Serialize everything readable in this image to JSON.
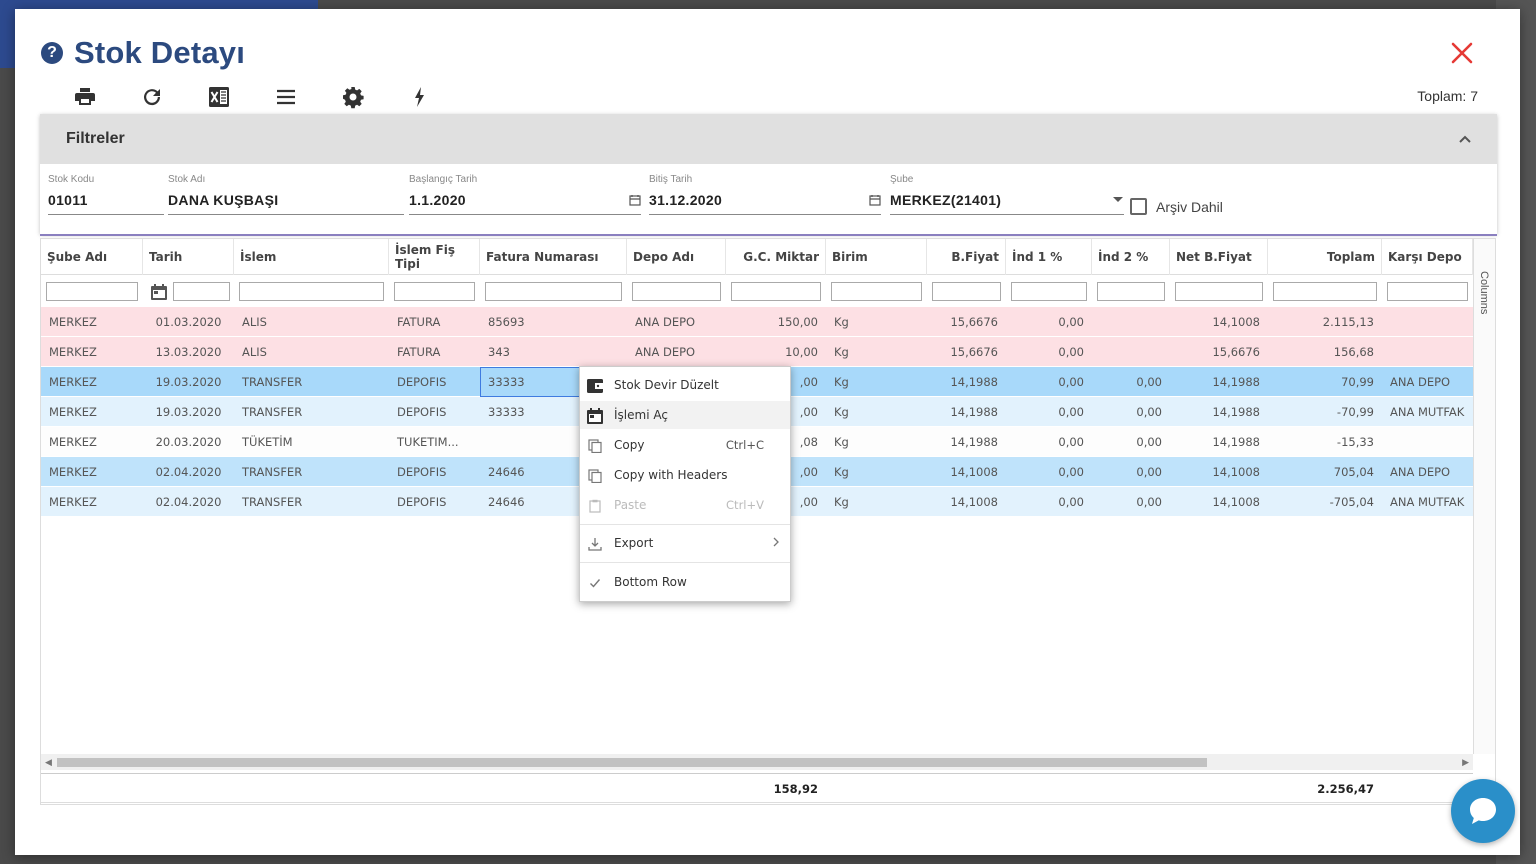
{
  "dialog": {
    "title": "Stok Detayı",
    "total_label": "Toplam: 7"
  },
  "toolbar": {
    "icons": [
      "printer-icon",
      "refresh-icon",
      "excel-icon",
      "menu-icon",
      "settings-icon",
      "flash-icon"
    ]
  },
  "filters": {
    "header": "Filtreler",
    "stok_kodu": {
      "label": "Stok Kodu",
      "value": "01011"
    },
    "stok_adi": {
      "label": "Stok Adı",
      "value": "DANA KUŞBAŞI"
    },
    "baslangic": {
      "label": "Başlangıç Tarih",
      "value": "1.1.2020"
    },
    "bitis": {
      "label": "Bitiş Tarih",
      "value": "31.12.2020"
    },
    "sube": {
      "label": "Şube",
      "value": "MERKEZ(21401)"
    },
    "arsiv": {
      "label": "Arşiv Dahil"
    }
  },
  "grid": {
    "columns": [
      "Şube Adı",
      "Tarih",
      "İslem",
      "İslem Fiş Tipi",
      "Fatura Numarası",
      "Depo Adı",
      "G.C. Miktar",
      "Birim",
      "B.Fiyat",
      "İnd 1 %",
      "İnd 2 %",
      "Net B.Fiyat",
      "Toplam",
      "Karşı Depo"
    ],
    "columns_panel_label": "Columns",
    "rows": [
      {
        "sube": "MERKEZ",
        "tarih": "01.03.2020",
        "islem": "ALIS",
        "fis": "FATURA",
        "fatura": "85693",
        "depo": "ANA DEPO",
        "miktar": "150,00",
        "birim": "Kg",
        "bfiyat": "15,6676",
        "ind1": "0,00",
        "ind2": "",
        "net": "14,1008",
        "toplam": "2.115,13",
        "karsi": ""
      },
      {
        "sube": "MERKEZ",
        "tarih": "13.03.2020",
        "islem": "ALIS",
        "fis": "FATURA",
        "fatura": "343",
        "depo": "ANA DEPO",
        "miktar": "10,00",
        "birim": "Kg",
        "bfiyat": "15,6676",
        "ind1": "0,00",
        "ind2": "",
        "net": "15,6676",
        "toplam": "156,68",
        "karsi": ""
      },
      {
        "sube": "MERKEZ",
        "tarih": "19.03.2020",
        "islem": "TRANSFER",
        "fis": "DEPOFIS",
        "fatura": "33333",
        "depo": "",
        "miktar": ",00",
        "birim": "Kg",
        "bfiyat": "14,1988",
        "ind1": "0,00",
        "ind2": "0,00",
        "net": "14,1988",
        "toplam": "70,99",
        "karsi": "ANA DEPO"
      },
      {
        "sube": "MERKEZ",
        "tarih": "19.03.2020",
        "islem": "TRANSFER",
        "fis": "DEPOFIS",
        "fatura": "33333",
        "depo": "",
        "miktar": ",00",
        "birim": "Kg",
        "bfiyat": "14,1988",
        "ind1": "0,00",
        "ind2": "0,00",
        "net": "14,1988",
        "toplam": "-70,99",
        "karsi": "ANA MUTFAK"
      },
      {
        "sube": "MERKEZ",
        "tarih": "20.03.2020",
        "islem": "TÜKETİM",
        "fis": "TUKETIM...",
        "fatura": "",
        "depo": "",
        "miktar": ",08",
        "birim": "Kg",
        "bfiyat": "14,1988",
        "ind1": "0,00",
        "ind2": "0,00",
        "net": "14,1988",
        "toplam": "-15,33",
        "karsi": ""
      },
      {
        "sube": "MERKEZ",
        "tarih": "02.04.2020",
        "islem": "TRANSFER",
        "fis": "DEPOFIS",
        "fatura": "24646",
        "depo": "",
        "miktar": ",00",
        "birim": "Kg",
        "bfiyat": "14,1008",
        "ind1": "0,00",
        "ind2": "0,00",
        "net": "14,1008",
        "toplam": "705,04",
        "karsi": "ANA DEPO"
      },
      {
        "sube": "MERKEZ",
        "tarih": "02.04.2020",
        "islem": "TRANSFER",
        "fis": "DEPOFIS",
        "fatura": "24646",
        "depo": "",
        "miktar": ",00",
        "birim": "Kg",
        "bfiyat": "14,1008",
        "ind1": "0,00",
        "ind2": "0,00",
        "net": "14,1008",
        "toplam": "-705,04",
        "karsi": "ANA MUTFAK"
      }
    ],
    "footer": {
      "miktar": "158,92",
      "toplam": "2.256,47"
    }
  },
  "context_menu": {
    "stok_devir": "Stok Devir Düzelt",
    "islemi_ac": "İşlemi Aç",
    "copy": "Copy",
    "copy_shortcut": "Ctrl+C",
    "copy_headers": "Copy with Headers",
    "paste": "Paste",
    "paste_shortcut": "Ctrl+V",
    "export": "Export",
    "bottom_row": "Bottom Row"
  },
  "colors": {
    "title": "#2c4a7f",
    "close": "#e53935",
    "row_pink": "#fde0e4",
    "row_blue": "#bfe3fb",
    "chat": "#2a8fc9"
  }
}
